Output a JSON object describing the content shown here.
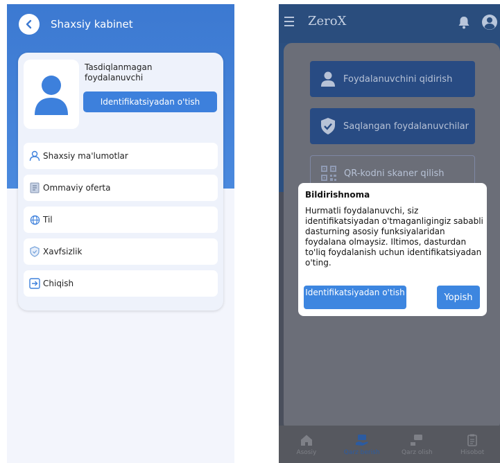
{
  "left": {
    "title": "Shaxsiy kabinet",
    "status": "Tasdiqlanmagan foydalanuvchi",
    "verify_button": "Identifikatsiyadan o'tish",
    "menu": [
      {
        "label": "Shaxsiy ma'lumotlar",
        "icon": "user-icon"
      },
      {
        "label": "Ommaviy oferta",
        "icon": "document-icon"
      },
      {
        "label": "Til",
        "icon": "globe-icon"
      },
      {
        "label": "Xavfsizlik",
        "icon": "shield-icon"
      },
      {
        "label": "Chiqish",
        "icon": "logout-icon"
      }
    ],
    "colors": {
      "header": "#3c79d1",
      "accent": "#3d80dc"
    }
  },
  "right": {
    "app_name": "ZeroX",
    "actions": {
      "search_user": "Foydalanuvchini qidirish",
      "saved_users": "Saqlangan foydalanuvchilar",
      "scan_qr": "QR-kodni skaner qilish"
    },
    "dialog": {
      "title": "Bildirishnoma",
      "message": "Hurmatli foydalanuvchi, siz identifikatsiyadan o'tmaganligingiz sababli dasturning asosiy funksiyalaridan foydalana olmaysiz. Iltimos, dasturdan to'liq foydalanish uchun identifikatsiyadan o'ting.",
      "verify_button": "Identifikatsiyadan o'tish",
      "close_button": "Yopish"
    },
    "nav": [
      {
        "label": "Asosiy",
        "icon": "home-icon",
        "active": false
      },
      {
        "label": "Qarz berish",
        "icon": "money-give-icon",
        "active": true
      },
      {
        "label": "Qarz olish",
        "icon": "money-take-icon",
        "active": false
      },
      {
        "label": "Hisobot",
        "icon": "report-icon",
        "active": false
      }
    ]
  }
}
